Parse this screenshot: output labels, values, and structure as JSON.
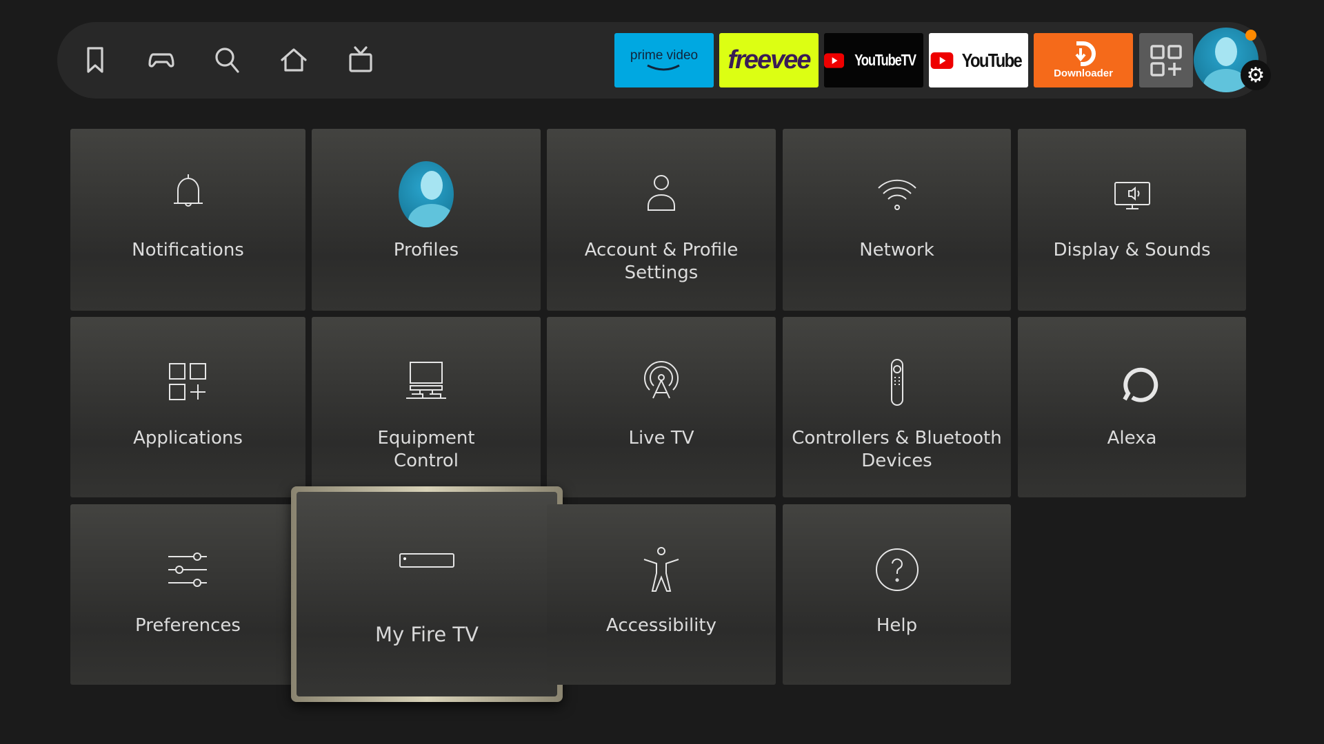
{
  "nav": {
    "items": [
      {
        "name": "bookmark-icon"
      },
      {
        "name": "game-controller-icon"
      },
      {
        "name": "search-icon"
      },
      {
        "name": "home-icon"
      },
      {
        "name": "live-tv-icon"
      }
    ]
  },
  "apps": [
    {
      "label": "prime video",
      "color": "#00a8e1"
    },
    {
      "label": "freevee",
      "color": "#dcff13"
    },
    {
      "label": "YouTubeTV",
      "color": "#050505"
    },
    {
      "label": "YouTube",
      "color": "#ffffff"
    },
    {
      "label": "Downloader",
      "color": "#f56a1a"
    }
  ],
  "settings": {
    "tiles": [
      {
        "label": "Notifications",
        "icon": "bell-icon"
      },
      {
        "label": "Profiles",
        "icon": "profile-avatar-icon"
      },
      {
        "label": "Account & Profile Settings",
        "icon": "person-icon"
      },
      {
        "label": "Network",
        "icon": "wifi-icon"
      },
      {
        "label": "Display & Sounds",
        "icon": "display-sound-icon"
      },
      {
        "label": "Applications",
        "icon": "apps-icon"
      },
      {
        "label": "Equipment Control",
        "icon": "equipment-icon"
      },
      {
        "label": "Live TV",
        "icon": "antenna-icon"
      },
      {
        "label": "Controllers & Bluetooth Devices",
        "icon": "remote-icon"
      },
      {
        "label": "Alexa",
        "icon": "alexa-icon"
      },
      {
        "label": "Preferences",
        "icon": "sliders-icon"
      },
      {
        "label": "My Fire TV",
        "icon": "fire-tv-device-icon",
        "focused": true
      },
      {
        "label": "Accessibility",
        "icon": "accessibility-icon"
      },
      {
        "label": "Help",
        "icon": "help-icon"
      }
    ]
  },
  "colors": {
    "focus_border": "#d8d2b8",
    "avatar": "#1a8db5",
    "notification_dot": "#ff8a00"
  }
}
